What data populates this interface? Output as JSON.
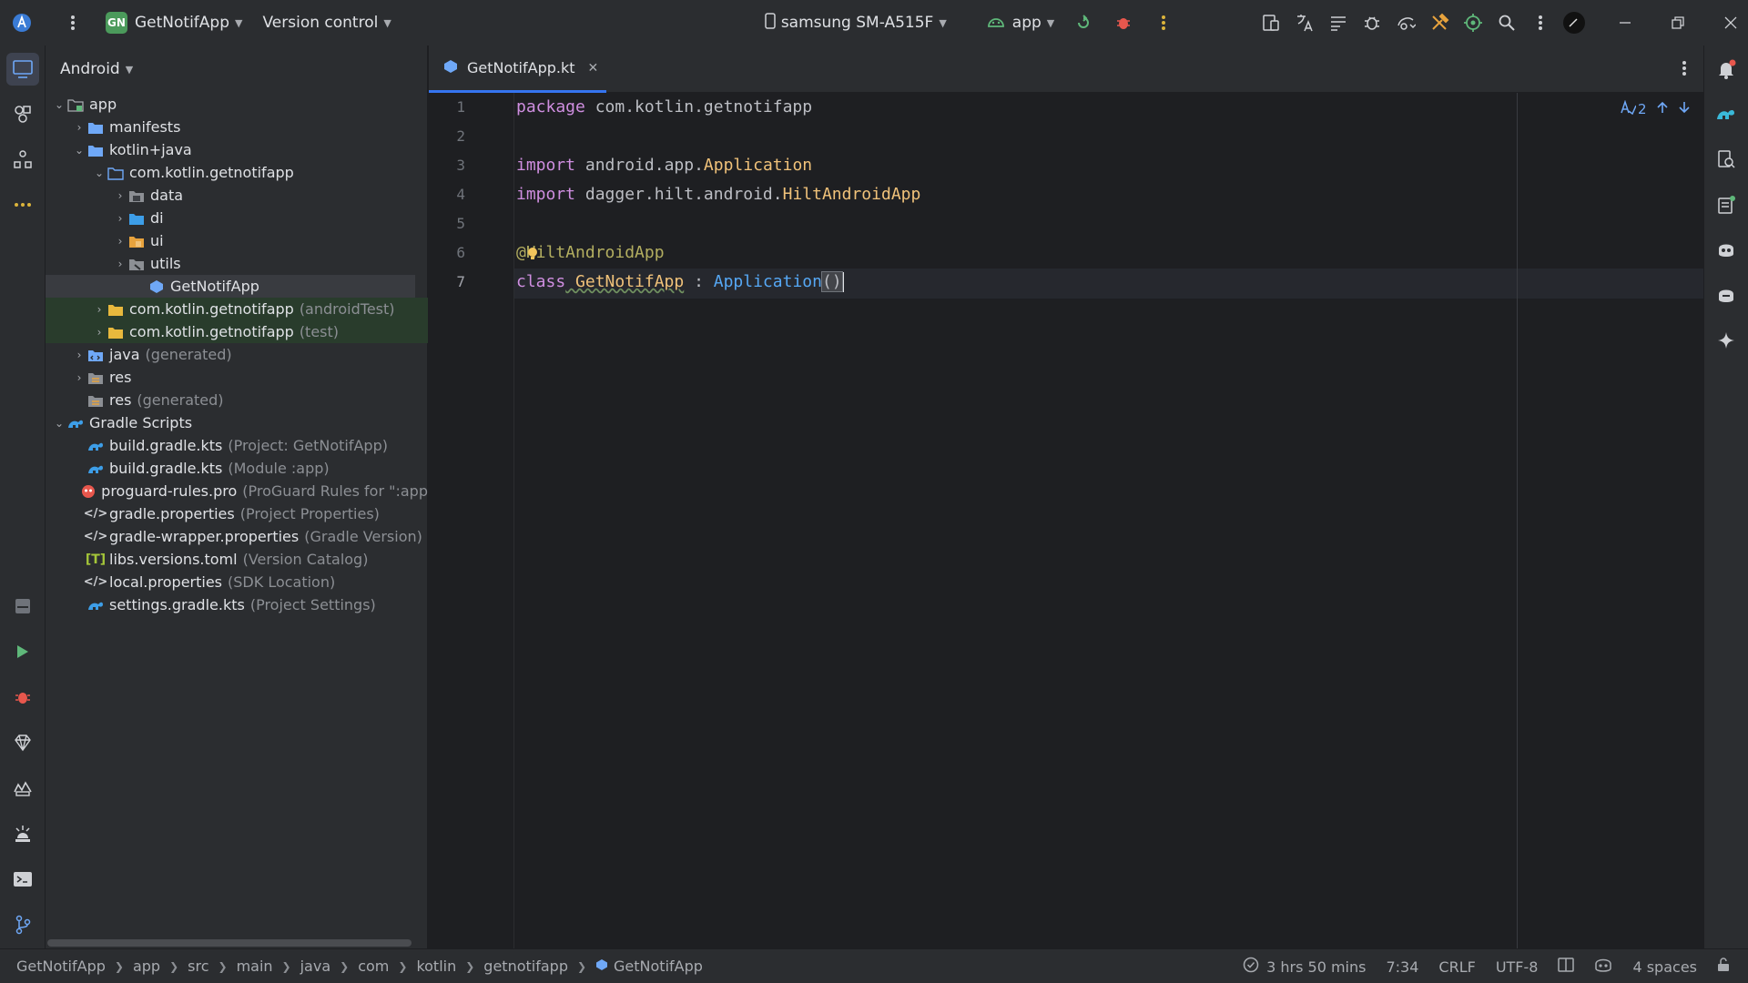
{
  "titlebar": {
    "project_badge": "GN",
    "project_name": "GetNotifApp",
    "vcs": "Version control",
    "device": "samsung SM-A515F",
    "run_config": "app"
  },
  "panel": {
    "view": "Android",
    "tree": [
      {
        "label": "app",
        "muted": ""
      },
      {
        "label": "manifests",
        "muted": ""
      },
      {
        "label": "kotlin+java",
        "muted": ""
      },
      {
        "label": "com.kotlin.getnotifapp",
        "muted": ""
      },
      {
        "label": "data",
        "muted": ""
      },
      {
        "label": "di",
        "muted": ""
      },
      {
        "label": "ui",
        "muted": ""
      },
      {
        "label": "utils",
        "muted": ""
      },
      {
        "label": "GetNotifApp",
        "muted": ""
      },
      {
        "label": "com.kotlin.getnotifapp",
        "muted": "(androidTest)"
      },
      {
        "label": "com.kotlin.getnotifapp",
        "muted": "(test)"
      },
      {
        "label": "java",
        "muted": "(generated)"
      },
      {
        "label": "res",
        "muted": ""
      },
      {
        "label": "res",
        "muted": "(generated)"
      },
      {
        "label": "Gradle Scripts",
        "muted": ""
      },
      {
        "label": "build.gradle.kts",
        "muted": "(Project: GetNotifApp)"
      },
      {
        "label": "build.gradle.kts",
        "muted": "(Module :app)"
      },
      {
        "label": "proguard-rules.pro",
        "muted": "(ProGuard Rules for \":app"
      },
      {
        "label": "gradle.properties",
        "muted": "(Project Properties)"
      },
      {
        "label": "gradle-wrapper.properties",
        "muted": "(Gradle Version)"
      },
      {
        "label": "libs.versions.toml",
        "muted": "(Version Catalog)"
      },
      {
        "label": "local.properties",
        "muted": "(SDK Location)"
      },
      {
        "label": "settings.gradle.kts",
        "muted": "(Project Settings)"
      }
    ]
  },
  "editor": {
    "tab": "GetNotifApp.kt",
    "inspection_count": "2",
    "line_numbers": [
      "1",
      "2",
      "3",
      "4",
      "5",
      "6",
      "7"
    ],
    "code": {
      "l1_kw": "package",
      "l1_rest": " com.kotlin.getnotifapp",
      "l3_kw": "import",
      "l3_pkg": " android.app.",
      "l3_cls": "Application",
      "l4_kw": "import",
      "l4_pkg": " dagger.hilt.android.",
      "l4_cls": "HiltAndroidApp",
      "l6_ann": "@HiltAndroidApp",
      "l7_kw": "class",
      "l7_cls": " GetNotifApp",
      "l7_sep": " : ",
      "l7_ty": "Application",
      "l7_paren": "()"
    }
  },
  "status": {
    "breadcrumb": [
      "GetNotifApp",
      "app",
      "src",
      "main",
      "java",
      "com",
      "kotlin",
      "getnotifapp",
      "GetNotifApp"
    ],
    "time": "3 hrs 50 mins",
    "position": "7:34",
    "line_ending": "CRLF",
    "encoding": "UTF-8",
    "indent": "4 spaces"
  },
  "colors": {
    "accent": "#3574f0",
    "background": "#1e1f22",
    "panel": "#2b2d30",
    "selection": "#2e436e"
  }
}
